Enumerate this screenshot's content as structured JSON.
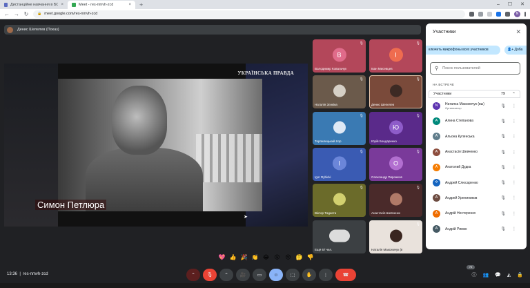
{
  "browser": {
    "tabs": [
      {
        "title": "Дистанційне навчання в БСТУІФІ",
        "color": "#5b6bc0"
      },
      {
        "title": "Meet - res-nmvh-zcd",
        "color": "#34a853"
      }
    ],
    "new_tab": "+",
    "url": "meet.google.com/res-nmvh-zcd",
    "profile_letter": "N"
  },
  "presenter_bar": {
    "text": "Денис Шепелев (Показ)"
  },
  "stage": {
    "brand": "УКРАЇНСЬКА ПРАВДА",
    "caption": "Симон Петлюра"
  },
  "tiles": [
    {
      "name": "Володимир Ковальчук",
      "letter": "В",
      "bg": "#b3475a",
      "avatar": "#e06b8a",
      "kind": "letter"
    },
    {
      "name": "Іван Мисевцев",
      "letter": "І",
      "bg": "#b3475a",
      "avatar": "#ef6c4f",
      "kind": "letter"
    },
    {
      "name": "Наталія Зєнкіна",
      "bg": "#6b5a4b",
      "avatar": "#d6d0c6",
      "kind": "photo"
    },
    {
      "name": "Денис Шепелев",
      "bg": "#7a4a3a",
      "avatar": "#3d2a24",
      "kind": "photo",
      "selected": true
    },
    {
      "name": "Терпилецький Ігор",
      "bg": "#3a7ab3",
      "avatar": "#dfe9f5",
      "kind": "photo"
    },
    {
      "name": "Юрій Бондаренко",
      "letter": "Ю",
      "bg": "#5a2a8a",
      "avatar": "#8e5cc9",
      "kind": "letter"
    },
    {
      "name": "Igor Rybicki",
      "letter": "I",
      "bg": "#3a5bb3",
      "avatar": "#6b86d9",
      "kind": "letter"
    },
    {
      "name": "Олександр Пирожков",
      "letter": "О",
      "bg": "#7a3a9a",
      "avatar": "#b26fd0",
      "kind": "letter"
    },
    {
      "name": "Віктор Тадиєта",
      "bg": "#6b6b2a",
      "avatar": "#d2d06f",
      "kind": "photo"
    },
    {
      "name": "Анастасія Шевченко",
      "bg": "#4a2a2a",
      "avatar": "#b07a68",
      "kind": "photo"
    },
    {
      "name": "Ещё 67 чел.",
      "bg": "#3c4043",
      "avatar": "#dcdcdc",
      "kind": "group"
    },
    {
      "name": "Наталія Максимчук (в",
      "bg": "#e9e2dc",
      "avatar": "#3a2620",
      "kind": "photo"
    }
  ],
  "people": {
    "title": "Участники",
    "close": "✕",
    "mute_all": "ключить микрофоны всех участников",
    "add": "Доба",
    "search_placeholder": "Поиск пользователей",
    "section": "НА ВСТРЕЧЕ",
    "group_label": "Участники",
    "group_count": "79",
    "list": [
      {
        "name": "Наталка Максимчук (вы)",
        "role": "Организатор",
        "initial": "N",
        "color": "#5e35b1"
      },
      {
        "name": "Алина Степанова",
        "initial": "А",
        "color": "#00897b"
      },
      {
        "name": "Альона Куленська",
        "initial": "А",
        "color": "#607d8b"
      },
      {
        "name": "Анастасія Шевченко",
        "initial": "А",
        "color": "#8d4e3e"
      },
      {
        "name": "Анатолий Дудка",
        "initial": "А",
        "color": "#f57c00"
      },
      {
        "name": "Андрей Слюсаренко",
        "initial": "✡",
        "color": "#1565c0"
      },
      {
        "name": "Андрей Хрениников",
        "initial": "А",
        "color": "#6d4c41"
      },
      {
        "name": "Андрій Нестеренко",
        "initial": "А",
        "color": "#ef6c00"
      },
      {
        "name": "Андрій Римко",
        "initial": "А",
        "color": "#455a64"
      }
    ]
  },
  "reactions": [
    "💖",
    "👍",
    "🎉",
    "👏",
    "😂",
    "😮",
    "😢",
    "🤔",
    "👎"
  ],
  "bottom": {
    "time": "13:36",
    "meeting_code": "res-nmvh-zcd",
    "participants_badge": "79"
  }
}
